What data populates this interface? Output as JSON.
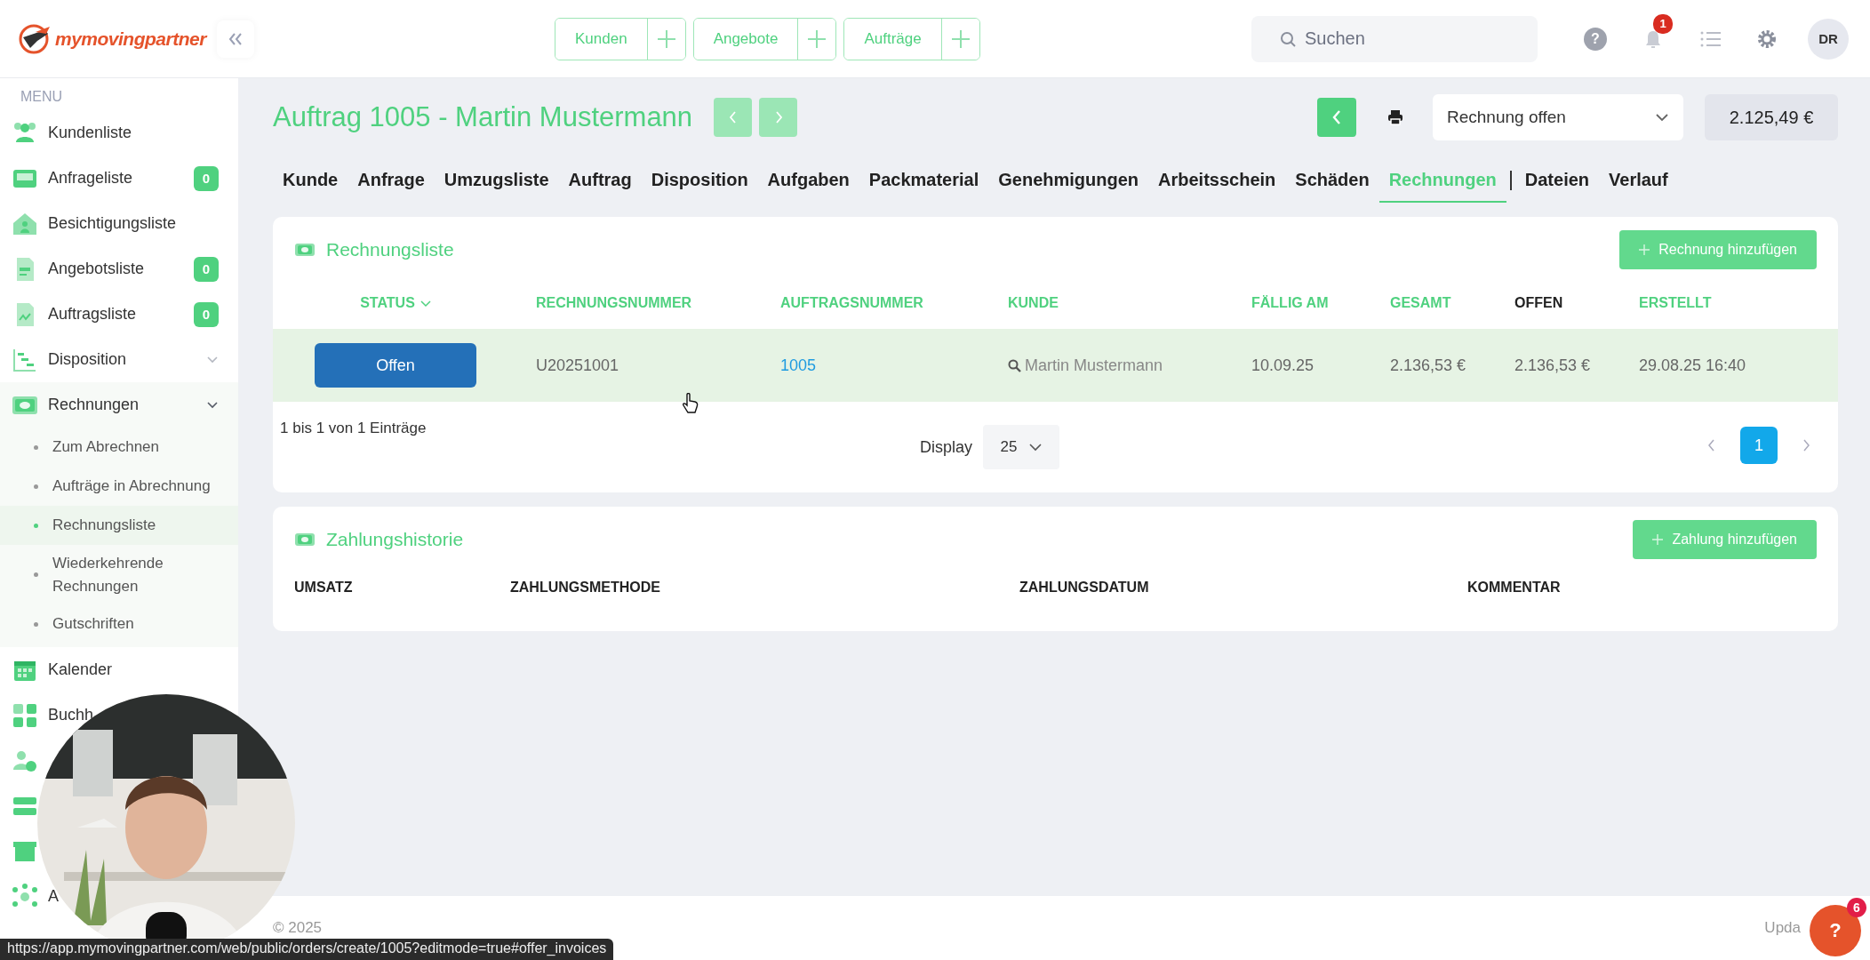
{
  "logo": {
    "text": "mymovingpartner"
  },
  "quick_create": [
    {
      "label": "Kunden"
    },
    {
      "label": "Angebote"
    },
    {
      "label": "Aufträge"
    }
  ],
  "search": {
    "placeholder": "Suchen"
  },
  "help": {
    "label": "?"
  },
  "notifications": {
    "badge": "1"
  },
  "user": {
    "initials": "DR"
  },
  "menu": {
    "heading": "MENU",
    "items": [
      {
        "label": "Kundenliste"
      },
      {
        "label": "Anfrageliste",
        "badge": "0"
      },
      {
        "label": "Besichtigungsliste"
      },
      {
        "label": "Angebotsliste",
        "badge": "0"
      },
      {
        "label": "Auftragsliste",
        "badge": "0"
      },
      {
        "label": "Disposition",
        "expanded": false
      },
      {
        "label": "Rechnungen",
        "expanded": true,
        "children": [
          {
            "label": "Zum Abrechnen",
            "selected": false
          },
          {
            "label": "Aufträge in Abrechnung",
            "selected": false
          },
          {
            "label": "Rechnungsliste",
            "selected": true
          },
          {
            "label": "Wiederkehrende Rechnungen",
            "selected": false
          },
          {
            "label": "Gutschriften",
            "selected": false
          }
        ]
      },
      {
        "label": "Kalender"
      },
      {
        "label": "Buchh"
      },
      {
        "kind": "icon_only"
      },
      {
        "kind": "icon_only"
      },
      {
        "kind": "icon_only"
      },
      {
        "label": "A"
      }
    ]
  },
  "page": {
    "title": "Auftrag 1005 - Martin Mustermann",
    "status_select": "Rechnung offen",
    "amount": "2.125,49 €"
  },
  "tabs": [
    {
      "label": "Kunde",
      "selected": false
    },
    {
      "label": "Anfrage",
      "selected": false
    },
    {
      "label": "Umzugsliste",
      "selected": false
    },
    {
      "label": "Auftrag",
      "selected": false
    },
    {
      "label": "Disposition",
      "selected": false
    },
    {
      "label": "Aufgaben",
      "selected": false
    },
    {
      "label": "Packmaterial",
      "selected": false
    },
    {
      "label": "Genehmigungen",
      "selected": false
    },
    {
      "label": "Arbeitsschein",
      "selected": false
    },
    {
      "label": "Schäden",
      "selected": false
    },
    {
      "label": "Rechnungen",
      "selected": true
    },
    {
      "label": "Dateien",
      "selected": false
    },
    {
      "label": "Verlauf",
      "selected": false
    }
  ],
  "invoices": {
    "title": "Rechnungsliste",
    "add_button": "Rechnung hinzufügen",
    "columns": [
      {
        "label": "STATUS",
        "active": false,
        "caret": true
      },
      {
        "label": "RECHNUNGSNUMMER",
        "active": false
      },
      {
        "label": "AUFTRAGSNUMMER",
        "active": false
      },
      {
        "label": "KUNDE",
        "active": false
      },
      {
        "label": "FÄLLIG AM",
        "active": false
      },
      {
        "label": "GESAMT",
        "active": false
      },
      {
        "label": "OFFEN",
        "active": true
      },
      {
        "label": "ERSTELLT",
        "active": false
      }
    ],
    "rows": [
      {
        "status": "Offen",
        "invoice_number": "U20251001",
        "order_number": "1005",
        "customer": "Martin Mustermann",
        "due": "10.09.25",
        "total": "2.136,53 €",
        "open": "2.136,53 €",
        "created": "29.08.25 16:40",
        "selected": true
      }
    ],
    "info": "1 bis 1 von 1 Einträge",
    "page_size_label": "Display",
    "page_size": "25",
    "pages": [
      {
        "label": "1",
        "selected": true
      }
    ]
  },
  "payments": {
    "title": "Zahlungshistorie",
    "add_button": "Zahlung hinzufügen",
    "columns": [
      {
        "label": "UMSATZ"
      },
      {
        "label": "ZAHLUNGSMETHODE"
      },
      {
        "label": "ZAHLUNGSDATUM"
      },
      {
        "label": "KOMMENTAR"
      }
    ]
  },
  "footer": {
    "copyright": "© 2025",
    "right": "Upda"
  },
  "support_button": {
    "label": "?",
    "badge": "6"
  },
  "status_url": "https://app.mymovingpartner.com/web/public/orders/create/1005?editmode=true#offer_invoices"
}
